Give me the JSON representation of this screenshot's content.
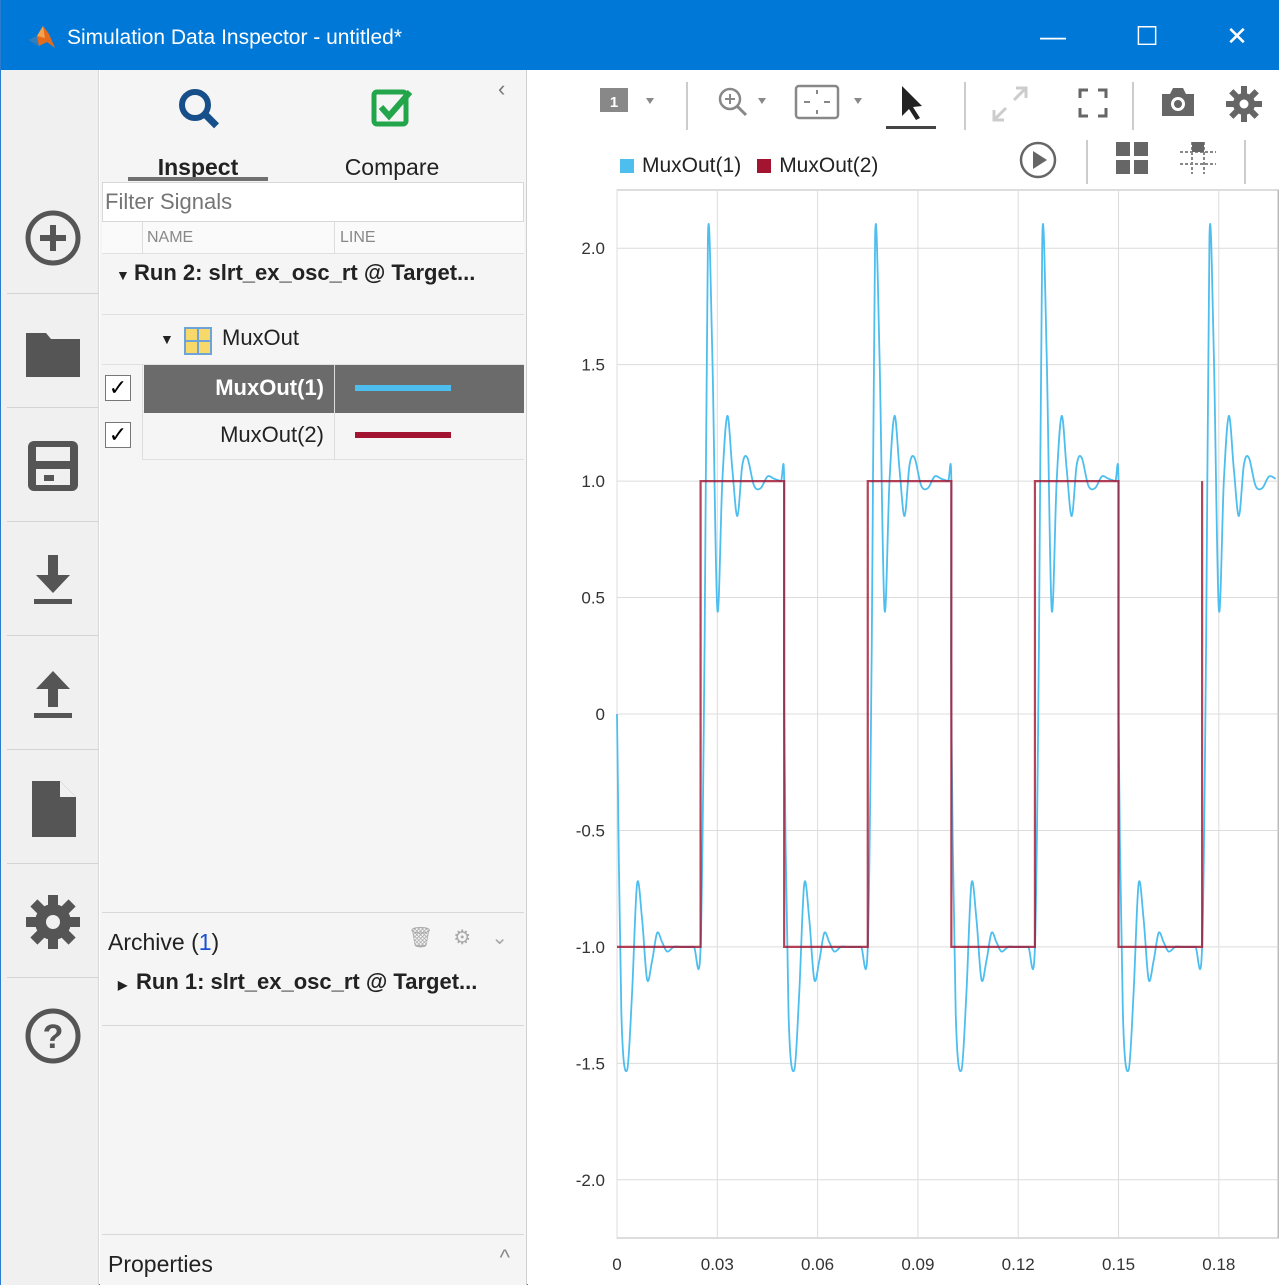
{
  "window": {
    "title": "Simulation Data Inspector - untitled*",
    "minimize_glyph": "—",
    "maximize_glyph": "☐",
    "close_glyph": "✕"
  },
  "rail": {
    "items": [
      {
        "name": "new-icon"
      },
      {
        "name": "open-folder-icon"
      },
      {
        "name": "save-icon"
      },
      {
        "name": "import-icon"
      },
      {
        "name": "export-icon"
      },
      {
        "name": "report-icon"
      },
      {
        "name": "settings-gear-icon"
      },
      {
        "name": "help-icon"
      }
    ]
  },
  "panel": {
    "tabs": [
      {
        "label": "Inspect",
        "icon": "search-icon"
      },
      {
        "label": "Compare",
        "icon": "check-icon"
      }
    ],
    "collapse_glyph": "‹",
    "filter_placeholder": "Filter Signals",
    "columns": {
      "name": "NAME",
      "line": "LINE"
    },
    "run_current": "Run 2: slrt_ex_osc_rt @ Target...",
    "group": "MuxOut",
    "signals": [
      {
        "name": "MuxOut(1)",
        "checked": "✓",
        "color": "#4dbeee",
        "selected": true
      },
      {
        "name": "MuxOut(2)",
        "checked": "✓",
        "color": "#a2142f",
        "selected": false
      }
    ],
    "archive": {
      "label": "Archive (",
      "count": "1",
      "close": ")",
      "run": "Run 1: slrt_ex_osc_rt @ Target..."
    },
    "properties": "Properties",
    "properties_chevron": "^"
  },
  "toolbar": {
    "layout_badge": "1"
  },
  "chart_data": {
    "type": "line",
    "title": "",
    "xlabel": "",
    "ylabel": "",
    "xlim": [
      0,
      0.198
    ],
    "ylim": [
      -2.25,
      2.25
    ],
    "x_ticks": [
      "0",
      "0.03",
      "0.06",
      "0.09",
      "0.12",
      "0.15",
      "0.18"
    ],
    "y_ticks": [
      "2.0",
      "1.5",
      "1.0",
      "0.5",
      "0",
      "-0.5",
      "-1.0",
      "-1.5",
      "-2.0"
    ],
    "grid": true,
    "legend_position": "top-left",
    "series": [
      {
        "name": "MuxOut(1)",
        "color": "#4dbeee",
        "description_points": {
          "x": [
            0,
            0.0013,
            0.003,
            0.0045,
            0.006,
            0.0075,
            0.009,
            0.0105,
            0.012,
            0.0135,
            0.015,
            0.017,
            0.019,
            0.021,
            0.023,
            0.025,
            0.0262,
            0.0272,
            0.0285,
            0.03,
            0.0315,
            0.033,
            0.0345,
            0.036,
            0.0375,
            0.039,
            0.041,
            0.043,
            0.045,
            0.047,
            0.049,
            0.05
          ],
          "y": [
            0,
            -1.28,
            -1.53,
            -1.2,
            -0.73,
            -0.88,
            -1.14,
            -1.06,
            -0.94,
            -0.98,
            -1.02,
            -1.0,
            -1.0,
            -1.0,
            -1.0,
            -1.0,
            0.3,
            2.05,
            1.55,
            0.45,
            1.0,
            1.28,
            1.05,
            0.85,
            1.07,
            1.1,
            0.98,
            0.97,
            1.02,
            1.01,
            1.0,
            1.0
          ]
        }
      },
      {
        "name": "MuxOut(2)",
        "color": "#a2142f",
        "description_points": {
          "x": [
            0,
            0.025,
            0.025,
            0.05
          ],
          "y": [
            -1,
            -1,
            1,
            1
          ]
        }
      }
    ],
    "period": 0.05
  }
}
